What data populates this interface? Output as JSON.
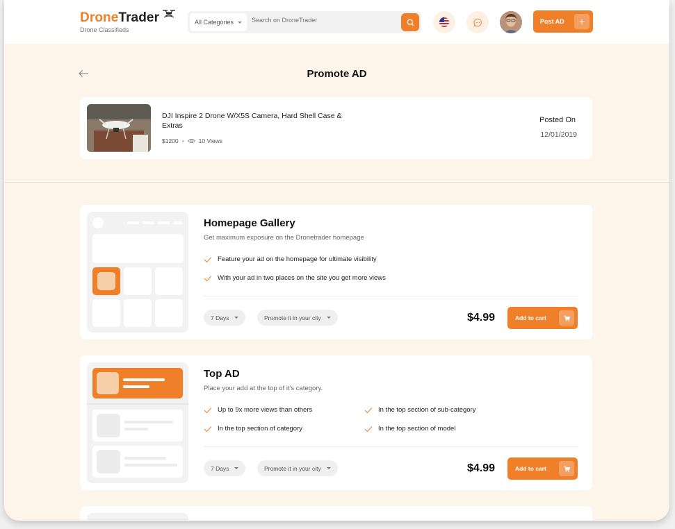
{
  "header": {
    "logo_drone": "Drone",
    "logo_trader": "Trader",
    "logo_sub": "Drone Classifieds",
    "category_selected": "All Categories",
    "search_placeholder": "Search on DroneTrader",
    "post_ad_label": "Post AD"
  },
  "page": {
    "title": "Promote AD"
  },
  "ad": {
    "title": "DJI Inspire 2 Drone W/X5S Camera, Hard Shell Case &  Extras",
    "price": "$1200",
    "views": "10 Views",
    "posted_label": "Posted On",
    "posted_date": "12/01/2019"
  },
  "promotions": [
    {
      "title": "Homepage Gallery",
      "description": "Get maximum exposure on the Dronetrader homepage",
      "features": [
        "Feature your ad on the homepage for ultimate visibility",
        "With your ad in two places on the site you get more views"
      ],
      "duration": "7 Days",
      "location": "Promote it in your city",
      "price": "$4.99",
      "cart_label": "Add to cart"
    },
    {
      "title": "Top AD",
      "description": "Place your add at the top of it's category.",
      "features": [
        "Up to 9x more views than others",
        "In the top section of sub-category",
        "In the top section of category",
        "In the top section of model"
      ],
      "duration": "7 Days",
      "location": "Promote it in your city",
      "price": "$4.99",
      "cart_label": "Add to cart"
    }
  ],
  "colors": {
    "accent": "#f07f2a",
    "page_bg": "#fdf5ea",
    "card_bg": "#ffffff"
  },
  "icons": {
    "back": "arrow-left-icon",
    "search": "search-icon",
    "flag": "us-flag-icon",
    "chat": "chat-bubble-icon",
    "plus": "plus-icon",
    "cart": "cart-icon",
    "check": "check-icon",
    "eye": "eye-icon"
  }
}
